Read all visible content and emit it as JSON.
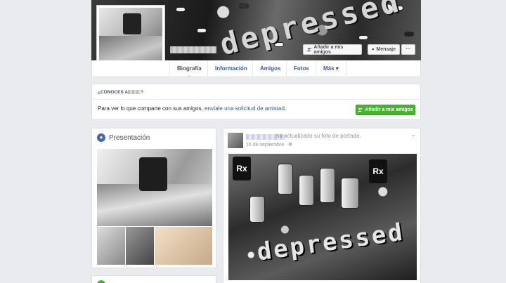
{
  "profile": {
    "buttons": {
      "add_friend": "Añadir a mis amigos",
      "message": "Mensaje",
      "more": "···"
    },
    "cover_text": "depressed"
  },
  "nav": {
    "tabs": [
      "Biografía",
      "Información",
      "Amigos",
      "Fotos",
      "Más"
    ],
    "more_arrow": "▾"
  },
  "know": {
    "heading": "¿CONOCES A",
    "heading_end": "?",
    "text_plain": "Para ver lo que comparte con sus amigos, ",
    "text_link": "envíale una solicitud de amistad.",
    "button": "Añadir a mis amigos"
  },
  "intro": {
    "title": "Presentación"
  },
  "post": {
    "action": "ha actualizado su foto de portada.",
    "date": "16 de septiembre",
    "date_sep": "·",
    "chevron": "⌄",
    "image_text": "depressed",
    "rx_label": "Rx"
  },
  "colors": {
    "accent": "#4267b2",
    "link": "#365899",
    "green": "#42b72a",
    "bg": "#e9ebee"
  },
  "icons": {
    "add_friend": "person-plus-icon",
    "message": "chat-bubble-icon",
    "globe": "globe-icon",
    "audience": "globe-small-icon"
  }
}
